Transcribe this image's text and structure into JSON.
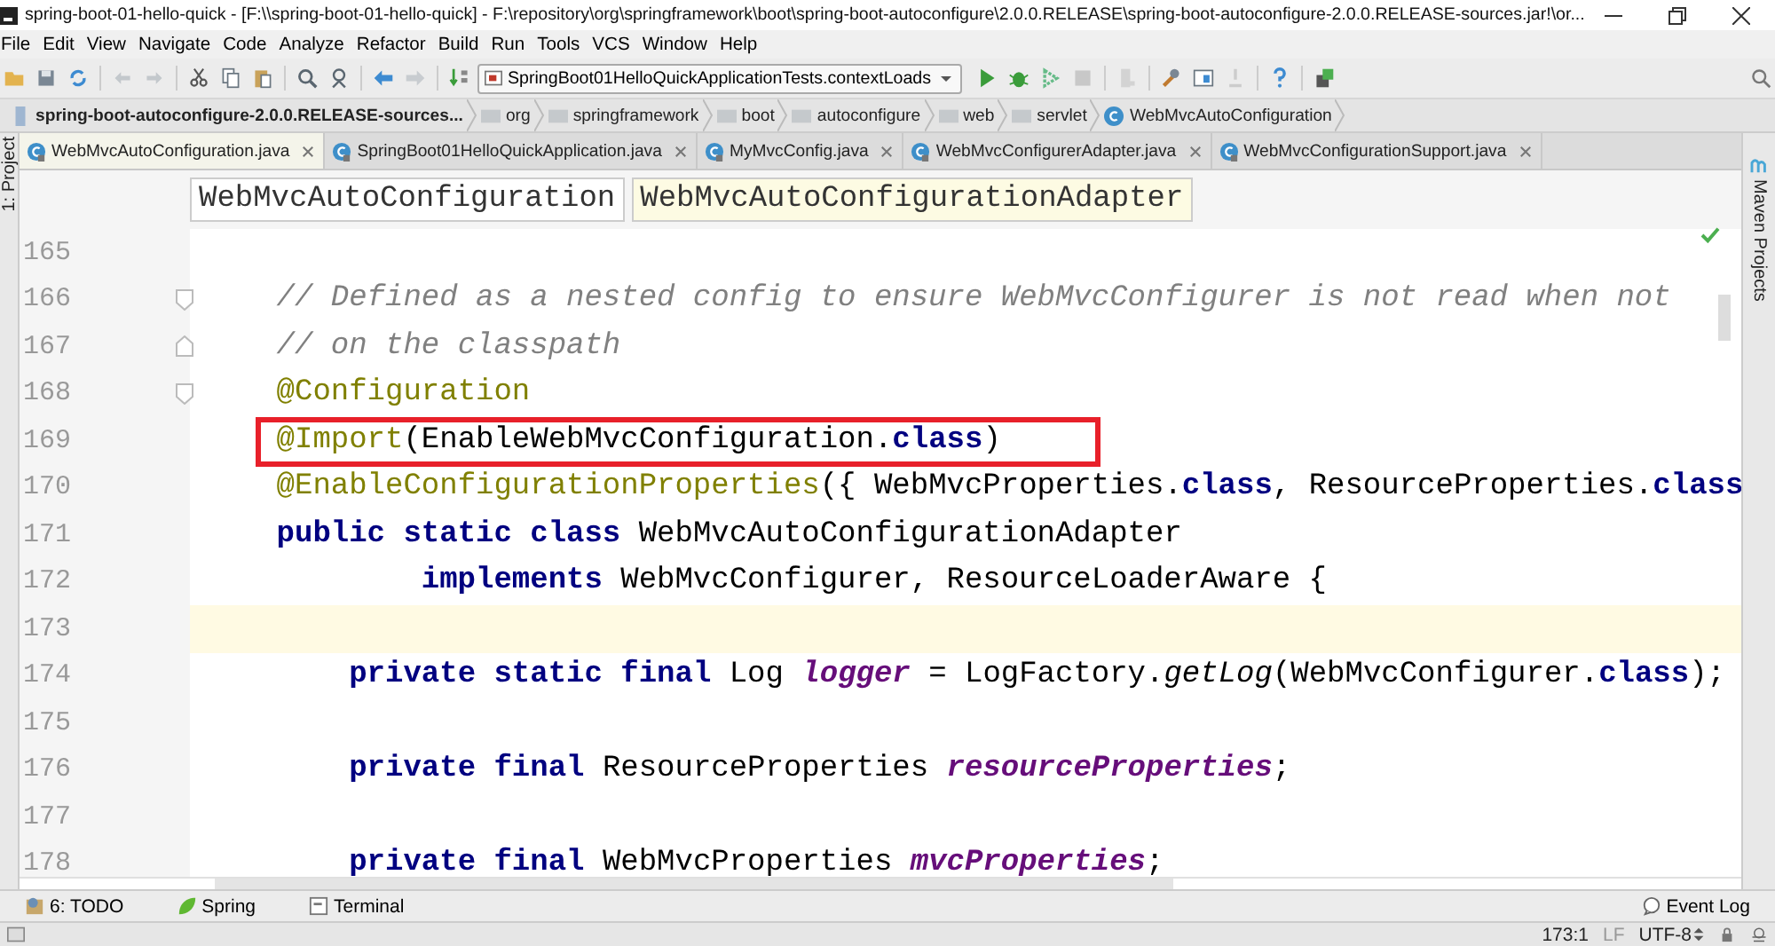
{
  "window": {
    "title": "spring-boot-01-hello-quick - [F:\\\\spring-boot-01-hello-quick] - F:\\repository\\org\\springframework\\boot\\spring-boot-autoconfigure\\2.0.0.RELEASE\\spring-boot-autoconfigure-2.0.0.RELEASE-sources.jar!\\or..."
  },
  "menu": [
    "File",
    "Edit",
    "View",
    "Navigate",
    "Code",
    "Analyze",
    "Refactor",
    "Build",
    "Run",
    "Tools",
    "VCS",
    "Window",
    "Help"
  ],
  "toolbar": {
    "run_config": "SpringBoot01HelloQuickApplicationTests.contextLoads"
  },
  "breadcrumbs": [
    {
      "label": "spring-boot-autoconfigure-2.0.0.RELEASE-sources...",
      "kind": "jar"
    },
    {
      "label": "org",
      "kind": "folder"
    },
    {
      "label": "springframework",
      "kind": "folder"
    },
    {
      "label": "boot",
      "kind": "folder"
    },
    {
      "label": "autoconfigure",
      "kind": "folder"
    },
    {
      "label": "web",
      "kind": "folder"
    },
    {
      "label": "servlet",
      "kind": "folder"
    },
    {
      "label": "WebMvcAutoConfiguration",
      "kind": "class"
    }
  ],
  "tabs": [
    {
      "label": "WebMvcAutoConfiguration.java",
      "selected": true
    },
    {
      "label": "SpringBoot01HelloQuickApplication.java",
      "selected": false
    },
    {
      "label": "MyMvcConfig.java",
      "selected": false
    },
    {
      "label": "WebMvcConfigurerAdapter.java",
      "selected": false
    },
    {
      "label": "WebMvcConfigurationSupport.java",
      "selected": false
    }
  ],
  "side_panels": {
    "left": "1: Project",
    "right": "Maven Projects"
  },
  "structure_path": [
    {
      "label": "WebMvcAutoConfiguration",
      "selected": false
    },
    {
      "label": "WebMvcAutoConfigurationAdapter",
      "selected": true
    }
  ],
  "code": [
    {
      "number": "165"
    },
    {
      "number": "166",
      "kind": "class",
      "fold_start": true,
      "tokens": [
        {
          "kind": "comment",
          "t": "// Defined as a nested config to ensure WebMvcConfigurer is not read when not"
        }
      ]
    },
    {
      "number": "167",
      "kind": "class",
      "fold_end": true,
      "tokens": [
        {
          "kind": "comment",
          "t": "// on the classpath"
        }
      ]
    },
    {
      "number": "168",
      "kind": "class",
      "fold_start": true,
      "tokens": [
        {
          "kind": "annot",
          "t": "@Configuration"
        }
      ]
    },
    {
      "number": "169",
      "kind": "class",
      "boxed": true,
      "tokens": [
        {
          "kind": "annot",
          "t": "@Import"
        },
        {
          "kind": "plain",
          "t": "(EnableWebMvcConfiguration."
        },
        {
          "kind": "kw",
          "t": "class"
        },
        {
          "kind": "plain",
          "t": ")"
        }
      ]
    },
    {
      "number": "170",
      "kind": "class",
      "tokens": [
        {
          "kind": "annot",
          "t": "@EnableConfigurationProperties"
        },
        {
          "kind": "plain",
          "t": "({ WebMvcProperties."
        },
        {
          "kind": "kw",
          "t": "class"
        },
        {
          "kind": "plain",
          "t": ", ResourceProperties."
        },
        {
          "kind": "kw",
          "t": "class"
        }
      ]
    },
    {
      "number": "171",
      "kind": "class",
      "tokens": [
        {
          "kind": "kw",
          "t": "public static class "
        },
        {
          "kind": "plain",
          "t": "WebMvcAutoConfigurationAdapter"
        }
      ]
    },
    {
      "number": "172",
      "kind": "continuation",
      "tokens": [
        {
          "kind": "kw",
          "t": "implements "
        },
        {
          "kind": "plain",
          "t": "WebMvcConfigurer, ResourceLoaderAware {"
        }
      ]
    },
    {
      "number": "173",
      "current": true
    },
    {
      "number": "174",
      "kind": "member",
      "tokens": [
        {
          "kind": "kw",
          "t": "private static final "
        },
        {
          "kind": "plain",
          "t": "Log "
        },
        {
          "kind": "field",
          "t": "logger"
        },
        {
          "kind": "plain",
          "t": " = LogFactory."
        },
        {
          "kind": "static",
          "t": "getLog"
        },
        {
          "kind": "plain",
          "t": "(WebMvcConfigurer."
        },
        {
          "kind": "kw",
          "t": "class"
        },
        {
          "kind": "plain",
          "t": ");"
        }
      ]
    },
    {
      "number": "175"
    },
    {
      "number": "176",
      "kind": "member",
      "tokens": [
        {
          "kind": "kw",
          "t": "private final "
        },
        {
          "kind": "plain",
          "t": "ResourceProperties "
        },
        {
          "kind": "field",
          "t": "resourceProperties"
        },
        {
          "kind": "plain",
          "t": ";"
        }
      ]
    },
    {
      "number": "177"
    },
    {
      "number": "178",
      "kind": "member",
      "tokens": [
        {
          "kind": "kw",
          "t": "private final "
        },
        {
          "kind": "plain",
          "t": "WebMvcProperties "
        },
        {
          "kind": "field",
          "t": "mvcProperties"
        },
        {
          "kind": "plain",
          "t": ";"
        }
      ]
    }
  ],
  "tool_windows": [
    {
      "label": "6: TODO",
      "kind": "todo"
    },
    {
      "label": "Spring",
      "kind": "spring"
    },
    {
      "label": "Terminal",
      "kind": "terminal"
    }
  ],
  "event_log": "Event Log",
  "status_bar": {
    "position": "173:1",
    "line_separator": "LF",
    "encoding": "UTF-8"
  }
}
